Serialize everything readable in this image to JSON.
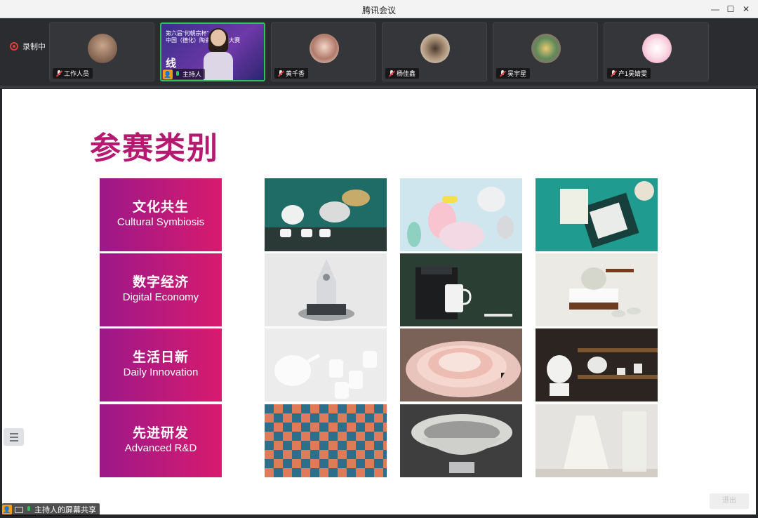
{
  "window": {
    "title": "腾讯会议"
  },
  "recording": {
    "label": "录制中"
  },
  "participants": [
    {
      "name": "工作人员"
    },
    {
      "name": "主持人",
      "host": true
    },
    {
      "name": "黄千香"
    },
    {
      "name": "杨佳鑫"
    },
    {
      "name": "吴宇星"
    },
    {
      "name": "产1吴婧雯"
    }
  ],
  "host_video": {
    "line1": "第六届“何朝宗杯”",
    "line2": "中国（德化）陶瓷",
    "line2_end": "大赛",
    "line3": "线"
  },
  "slide": {
    "title": "参赛类别",
    "categories": [
      {
        "zh": "文化共生",
        "en": "Cultural Symbiosis"
      },
      {
        "zh": "数字经济",
        "en": "Digital Economy"
      },
      {
        "zh": "生活日新",
        "en": "Daily Innovation"
      },
      {
        "zh": "先进研发",
        "en": "Advanced R&D"
      }
    ]
  },
  "share_label": "主持人的屏幕共享",
  "corner_button": "退出",
  "colors": {
    "accent": "#b51a70",
    "gradient_start": "#9c1889",
    "gradient_end": "#d81b6e",
    "recording": "#e23d3d",
    "active_speaker": "#2fc25b"
  }
}
